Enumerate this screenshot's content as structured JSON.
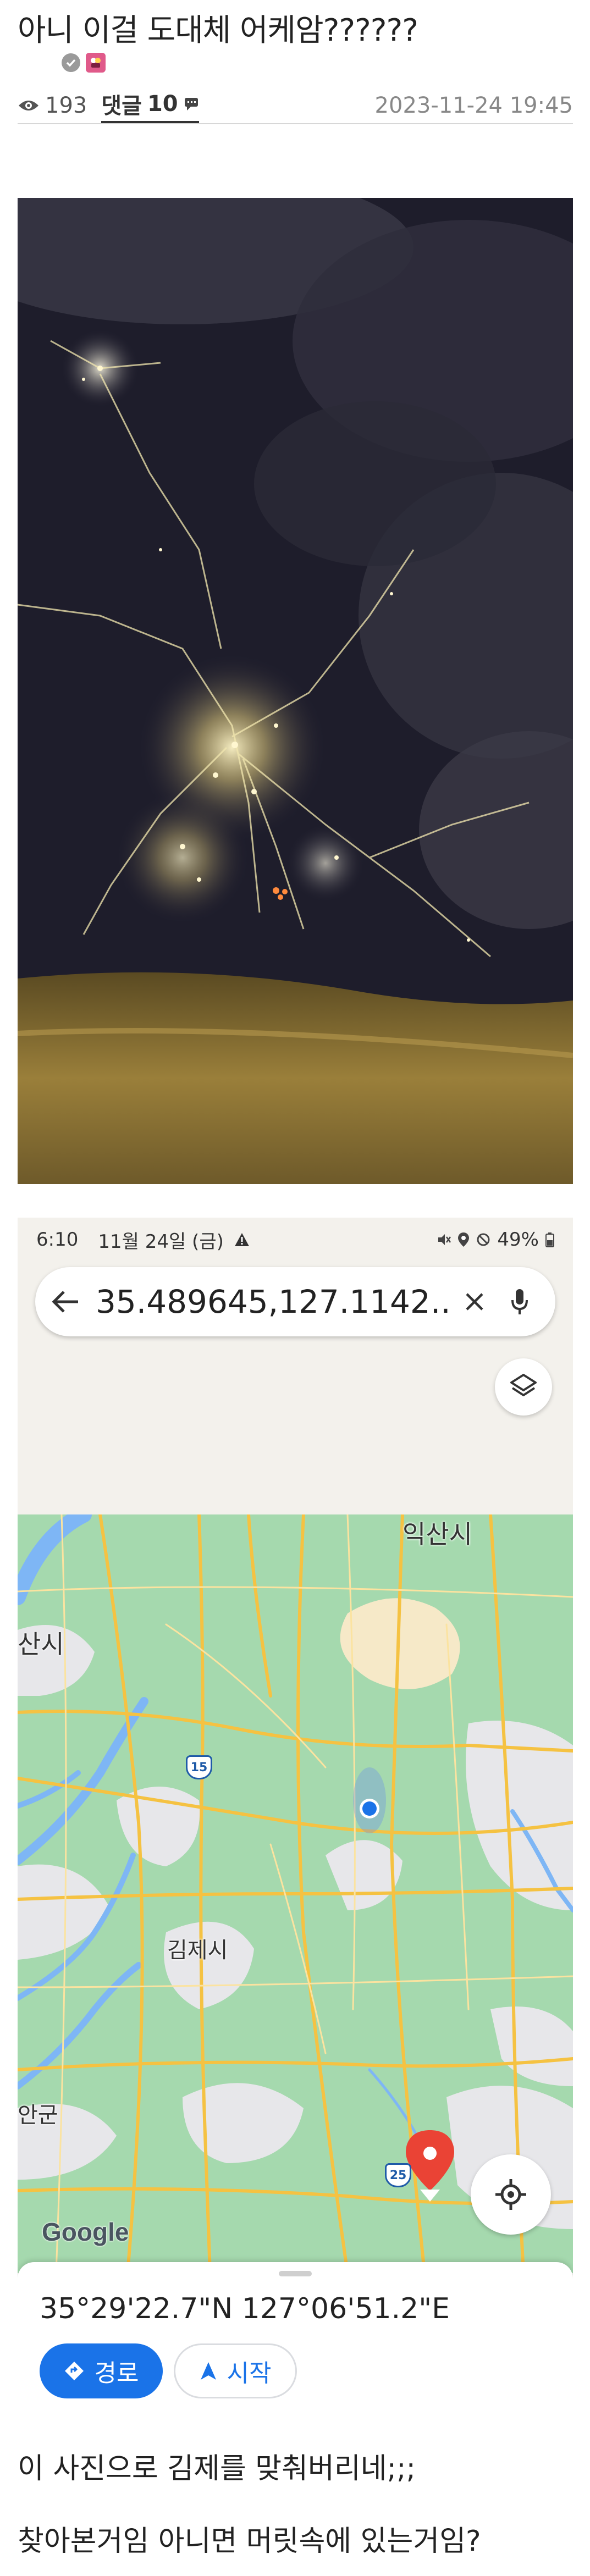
{
  "post": {
    "title": "아니 이걸 도대체 어케암??????",
    "views": "193",
    "comments_label": "댓글",
    "comments_count": "10",
    "date": "2023-11-24 19:45"
  },
  "map_screenshot": {
    "status_time": "6:10",
    "status_date": "11월 24일 (금)",
    "battery": "49%",
    "search_query": "35.489645,127.1142...",
    "place_labels": [
      "익산시",
      "산시",
      "김제시",
      "안군"
    ],
    "highway_shields": [
      "15",
      "25"
    ],
    "google_logo": "Google",
    "coordinates": "35°29'22.7\"N 127°06'51.2\"E",
    "route_button": "경로",
    "start_button": "시작",
    "colors": {
      "accent": "#1a73e8",
      "pin": "#ea4335",
      "map_green": "#9fd6a9",
      "road": "#f5c242"
    }
  },
  "body": {
    "line1": "이 사진으로 김제를 맞춰버리네;;;",
    "line2": "찾아본거임 아니면 머릿속에 있는거임?"
  }
}
